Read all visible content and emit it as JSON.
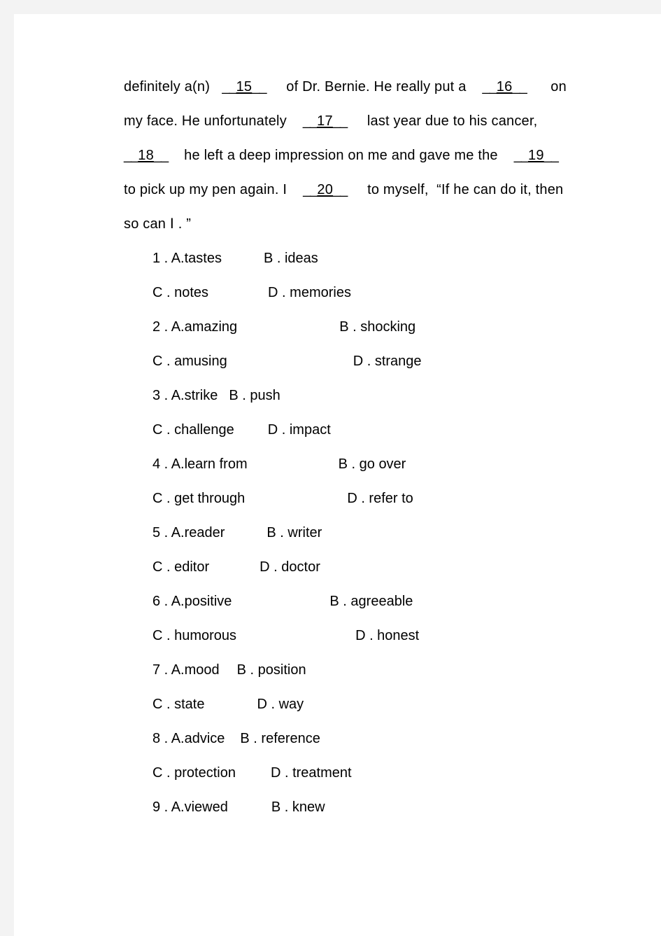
{
  "document": {
    "type": "cloze-test-worksheet",
    "cloze_paragraph": {
      "lines": [
        [
          {
            "kind": "text",
            "text": "definitely a(n)   "
          },
          {
            "kind": "blank",
            "number": "15"
          },
          {
            "kind": "text",
            "text": "     of Dr. Bernie. He really put a    "
          },
          {
            "kind": "blank",
            "number": "16"
          },
          {
            "kind": "text",
            "text": "      on"
          }
        ],
        [
          {
            "kind": "text",
            "text": "my face. He unfortunately    "
          },
          {
            "kind": "blank",
            "number": "17"
          },
          {
            "kind": "text",
            "text": "     last year due to his cancer,"
          }
        ],
        [
          {
            "kind": "blank",
            "number": "18"
          },
          {
            "kind": "text",
            "text": "    he left a deep impression on me and gave me the    "
          },
          {
            "kind": "blank",
            "number": "19"
          }
        ],
        [
          {
            "kind": "text",
            "text": "to pick up my pen again. I    "
          },
          {
            "kind": "blank",
            "number": "20"
          },
          {
            "kind": "text",
            "text": "     to myself,  “If he can do it, then"
          }
        ],
        [
          {
            "kind": "text",
            "text": "so can Ⅰ . ”"
          }
        ]
      ]
    },
    "questions": [
      {
        "number": "1",
        "rows": [
          [
            {
              "label": "1 . A.tastes",
              "indent": 0
            },
            {
              "label": "B . ideas",
              "indent": 60
            }
          ],
          [
            {
              "label": "C . notes",
              "indent": 0
            },
            {
              "label": "D . memories",
              "indent": 85
            }
          ]
        ]
      },
      {
        "number": "2",
        "rows": [
          [
            {
              "label": "2 . A.amazing",
              "indent": 0
            },
            {
              "label": "B . shocking",
              "indent": 146
            }
          ],
          [
            {
              "label": "C . amusing",
              "indent": 0
            },
            {
              "label": "D . strange",
              "indent": 180
            }
          ]
        ]
      },
      {
        "number": "3",
        "rows": [
          [
            {
              "label": "3 . A.strike",
              "indent": 0
            },
            {
              "label": "B . push",
              "indent": 16
            }
          ],
          [
            {
              "label": "C . challenge",
              "indent": 0
            },
            {
              "label": "D . impact",
              "indent": 48
            }
          ]
        ]
      },
      {
        "number": "4",
        "rows": [
          [
            {
              "label": "4 . A.learn from",
              "indent": 0
            },
            {
              "label": "B . go over",
              "indent": 130
            }
          ],
          [
            {
              "label": "C . get through",
              "indent": 0
            },
            {
              "label": "D . refer to",
              "indent": 146
            }
          ]
        ]
      },
      {
        "number": "5",
        "rows": [
          [
            {
              "label": "5 . A.reader",
              "indent": 0
            },
            {
              "label": "B . writer",
              "indent": 60
            }
          ],
          [
            {
              "label": "C . editor",
              "indent": 0
            },
            {
              "label": "D . doctor",
              "indent": 72
            }
          ]
        ]
      },
      {
        "number": "6",
        "rows": [
          [
            {
              "label": "6 . A.positive",
              "indent": 0
            },
            {
              "label": "B . agreeable",
              "indent": 140
            }
          ],
          [
            {
              "label": "C . humorous",
              "indent": 0
            },
            {
              "label": "D . honest",
              "indent": 170
            }
          ]
        ]
      },
      {
        "number": "7",
        "rows": [
          [
            {
              "label": "7 . A.mood",
              "indent": 0
            },
            {
              "label": "B . position",
              "indent": 25
            }
          ],
          [
            {
              "label": "C . state",
              "indent": 0
            },
            {
              "label": "D . way",
              "indent": 75
            }
          ]
        ]
      },
      {
        "number": "8",
        "rows": [
          [
            {
              "label": "8 . A.advice",
              "indent": 0
            },
            {
              "label": "B . reference",
              "indent": 22
            }
          ],
          [
            {
              "label": "C . protection",
              "indent": 0
            },
            {
              "label": "D . treatment",
              "indent": 50
            }
          ]
        ]
      },
      {
        "number": "9",
        "rows": [
          [
            {
              "label": "9 . A.viewed",
              "indent": 0
            },
            {
              "label": "B . knew",
              "indent": 62
            }
          ]
        ]
      }
    ]
  },
  "colors": {
    "page_background": "#ffffff",
    "canvas_background": "#f3f3f3",
    "text": "#000000"
  }
}
